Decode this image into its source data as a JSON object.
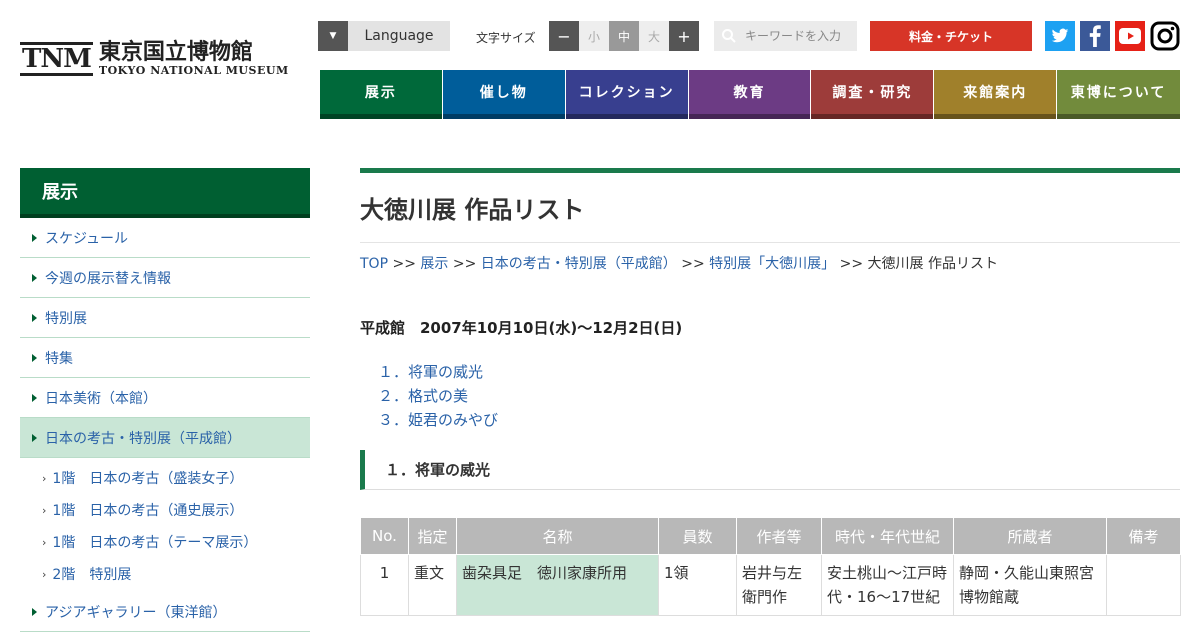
{
  "logo": {
    "mark": "TNM",
    "name_jp": "東京国立博物館",
    "name_en": "TOKYO NATIONAL MUSEUM"
  },
  "header": {
    "language_label": "Language",
    "font_size_label": "文字サイズ",
    "font_size_minus": "−",
    "font_size_small": "小",
    "font_size_medium": "中",
    "font_size_large": "大",
    "font_size_plus": "+",
    "search_placeholder": "キーワードを入力",
    "ticket_label": "料金・チケット"
  },
  "social": [
    {
      "icon": "twitter-icon",
      "color": "#1da1f2"
    },
    {
      "icon": "facebook-icon",
      "color": "#3b5998"
    },
    {
      "icon": "youtube-icon",
      "color": "#e62117"
    },
    {
      "icon": "instagram-icon",
      "color": "#000000"
    }
  ],
  "nav": [
    {
      "label": "展示",
      "color": "#00693a"
    },
    {
      "label": "催し物",
      "color": "#005d9a"
    },
    {
      "label": "コレクション",
      "color": "#383f8f"
    },
    {
      "label": "教育",
      "color": "#6c3b84"
    },
    {
      "label": "調査・研究",
      "color": "#9d3c3a"
    },
    {
      "label": "来館案内",
      "color": "#a0802b"
    },
    {
      "label": "東博について",
      "color": "#728b3c"
    }
  ],
  "sidebar": {
    "title": "展示",
    "items": [
      {
        "label": "スケジュール"
      },
      {
        "label": "今週の展示替え情報"
      },
      {
        "label": "特別展"
      },
      {
        "label": "特集"
      },
      {
        "label": "日本美術（本館）"
      },
      {
        "label": "日本の考古・特別展（平成館）"
      }
    ],
    "sub_items": [
      {
        "label": "1階　日本の考古（盛装女子）"
      },
      {
        "label": "1階　日本の考古（通史展示）"
      },
      {
        "label": "1階　日本の考古（テーマ展示）"
      },
      {
        "label": "2階　特別展"
      }
    ],
    "last_item": {
      "label": "アジアギャラリー（東洋館）"
    }
  },
  "page": {
    "title": "大徳川展 作品リスト",
    "breadcrumb": {
      "top": "TOP",
      "sep": ">>",
      "l1": "展示",
      "l2": "日本の考古・特別展（平成館）",
      "l3": "特別展「大徳川展」",
      "current": "大徳川展 作品リスト"
    },
    "venue": "平成館　2007年10月10日(水)～12月2日(日)",
    "toc": [
      "１．将軍の威光",
      "２．格式の美",
      "３．姫君のみやび"
    ],
    "section_title": "１．将軍の威光"
  },
  "table": {
    "headers": [
      "No.",
      "指定",
      "名称",
      "員数",
      "作者等",
      "時代・年代世紀",
      "所蔵者",
      "備考"
    ],
    "rows": [
      [
        "1",
        "重文",
        "歯朶具足　徳川家康所用",
        "1領",
        "岩井与左衛門作",
        "安土桃山～江戸時代・16～17世紀",
        "静岡・久能山東照宮博物館蔵",
        ""
      ]
    ]
  }
}
